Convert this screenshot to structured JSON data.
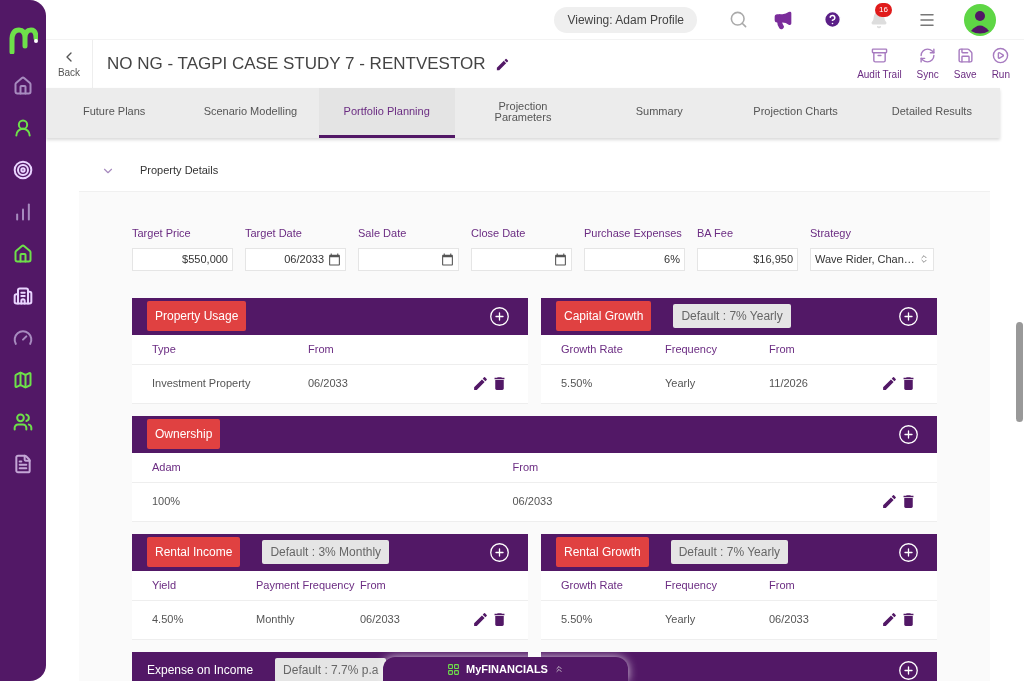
{
  "top_bar": {
    "viewing": "Viewing: Adam Profile",
    "notifications": "16"
  },
  "header": {
    "back": "Back",
    "title": "NO NG - TAGPI CASE STUDY 7 - RENTVESTOR",
    "actions": [
      {
        "kind": "audit",
        "label": "Audit Trail"
      },
      {
        "kind": "sync",
        "label": "Sync"
      },
      {
        "kind": "save",
        "label": "Save"
      },
      {
        "kind": "run",
        "label": "Run"
      }
    ]
  },
  "tabs": [
    {
      "label": "Future Plans",
      "selected": false
    },
    {
      "label": "Scenario Modelling",
      "selected": false
    },
    {
      "label": "Portfolio Planning",
      "selected": true
    },
    {
      "label": "Projection Parameters",
      "selected": false
    },
    {
      "label": "Summary",
      "selected": false
    },
    {
      "label": "Projection Charts",
      "selected": false
    },
    {
      "label": "Detailed Results",
      "selected": false
    }
  ],
  "section": {
    "title": "Property Details",
    "expanded": true
  },
  "fields": [
    {
      "kind": "text",
      "label": "Target Price",
      "value": "$550,000"
    },
    {
      "kind": "date",
      "label": "Target Date",
      "value": "06/2033"
    },
    {
      "kind": "date",
      "label": "Sale Date"
    },
    {
      "kind": "date",
      "label": "Close Date"
    },
    {
      "kind": "text",
      "label": "Purchase Expenses",
      "value": "6%"
    },
    {
      "kind": "text",
      "label": "BA Fee",
      "value": "$16,950"
    },
    {
      "kind": "select",
      "label": "Strategy",
      "value": "Wave Rider, Chan…"
    }
  ],
  "panel_rows": [
    {
      "panels": [
        {
          "kind": "table",
          "title": "Property Usage",
          "highlighted": true,
          "columns": [
            "Type",
            "From"
          ],
          "rows": [
            [
              "Investment Property",
              "06/2033"
            ]
          ]
        },
        {
          "kind": "table",
          "title": "Capital Growth",
          "highlighted": true,
          "default": "Default : 7% Yearly",
          "columns": [
            "Growth Rate",
            "Frequency",
            "From"
          ],
          "rows": [
            [
              "5.50%",
              "Yearly",
              "11/2026"
            ]
          ]
        }
      ]
    },
    {
      "panels": [
        {
          "kind": "table",
          "title": "Ownership",
          "highlighted": true,
          "columns": [
            "Adam",
            "From"
          ],
          "rows": [
            [
              "100%",
              "06/2033"
            ]
          ]
        }
      ]
    },
    {
      "panels": [
        {
          "kind": "table",
          "title": "Rental Income",
          "highlighted": true,
          "default": "Default : 3% Monthly",
          "columns": [
            "Yield",
            "Payment Frequency",
            "From"
          ],
          "rows": [
            [
              "4.50%",
              "Monthly",
              "06/2033"
            ]
          ]
        },
        {
          "kind": "table",
          "title": "Rental Growth",
          "highlighted": true,
          "default": "Default : 7% Yearly",
          "columns": [
            "Growth Rate",
            "Frequency",
            "From"
          ],
          "rows": [
            [
              "5.50%",
              "Yearly",
              "06/2033"
            ]
          ]
        }
      ]
    },
    {
      "panels": [
        {
          "kind": "header_only",
          "title": "Expense on Income",
          "highlighted": false,
          "default": "Default : 7.7% p.a"
        },
        {
          "kind": "header_only"
        }
      ]
    }
  ],
  "bottom_tab": {
    "label": "MyFINANCIALS"
  }
}
